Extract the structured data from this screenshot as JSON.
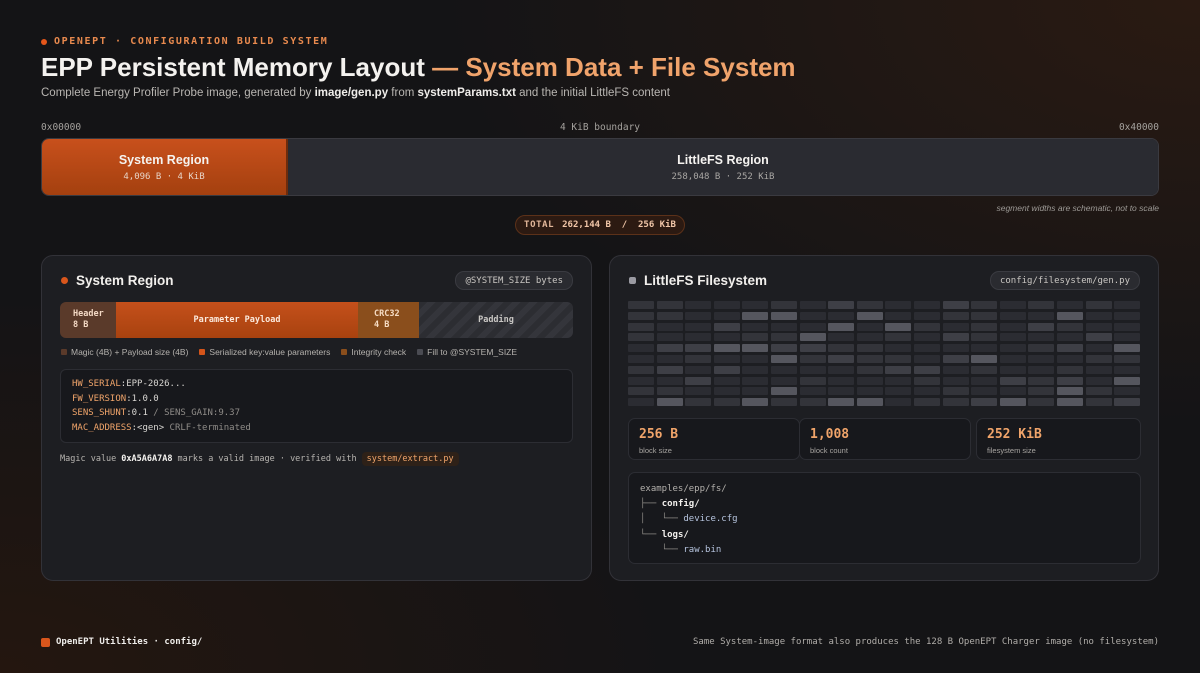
{
  "header": {
    "eyebrow": "OPENEPT · CONFIGURATION BUILD SYSTEM",
    "title_main": "EPP Persistent Memory Layout",
    "title_accent": "— System Data + File System",
    "subtitle_pre": "Complete Energy Profiler Probe image, generated by ",
    "subtitle_script": "image/gen.py",
    "subtitle_mid": " from ",
    "subtitle_params": "systemParams.txt",
    "subtitle_post": " and the initial LittleFS content"
  },
  "memory_map": {
    "start_addr": "0x00000",
    "boundary_label": "4 KiB boundary",
    "end_addr": "0x40000",
    "system": {
      "name": "System Region",
      "size": "4,096 B · 4 KiB"
    },
    "littlefs": {
      "name": "LittleFS Region",
      "size": "258,048 B · 252 KiB"
    },
    "schematic_note": "segment widths are schematic, not to scale",
    "total_label": "TOTAL",
    "total_value": "262,144 B  /  256 KiB"
  },
  "system_card": {
    "title": "System Region",
    "badge": "@SYSTEM_SIZE bytes",
    "segments": {
      "header_name": "Header",
      "header_size": "8 B",
      "payload": "Parameter Payload",
      "crc_name": "CRC32",
      "crc_size": "4 B",
      "padding": "Padding"
    },
    "legend": [
      {
        "label": "Magic (4B) + Payload size (4B)",
        "color": "#5a3a2a"
      },
      {
        "label": "Serialized key:value parameters",
        "color": "#d3541a"
      },
      {
        "label": "Integrity check",
        "color": "#8a4e1c"
      },
      {
        "label": "Fill to @SYSTEM_SIZE",
        "color": "#4a4b52"
      }
    ],
    "code": {
      "l1_key": "HW_SERIAL",
      "l1_val": "EPP-2026...",
      "l2_key": "FW_VERSION",
      "l2_val": "1.0.0",
      "l3_key": "SENS_SHUNT",
      "l3_val": "0.1",
      "l3_sep": " / ",
      "l3_extra": "SENS_GAIN:9.37",
      "l4_key": "MAC_ADDRESS",
      "l4_val": "<gen>",
      "l4_comment": "CRLF-terminated"
    },
    "magic_pre": "Magic value",
    "magic_value": "0xA5A6A7A8",
    "magic_mid": "marks a valid image · verified with",
    "magic_script": "system/extract.py"
  },
  "fs_card": {
    "title": "LittleFS Filesystem",
    "badge": "config/filesystem/gen.py",
    "stats": [
      {
        "value": "256 B",
        "label": "block size"
      },
      {
        "value": "1,008",
        "label": "block count"
      },
      {
        "value": "252 KiB",
        "label": "filesystem size"
      }
    ],
    "tree": {
      "root": "examples/epp/fs/",
      "dir1": "config/",
      "file1": "device.cfg",
      "dir2": "logs/",
      "file2": "raw.bin"
    }
  },
  "footer": {
    "left": "OpenEPT Utilities · config/",
    "right": "Same System-image format also produces the 128 B OpenEPT Charger image (no filesystem)"
  },
  "colors": {
    "accent": "#e5561a",
    "accent_light": "#f0a36b",
    "background": "#141416",
    "card": "#1d1e22"
  }
}
